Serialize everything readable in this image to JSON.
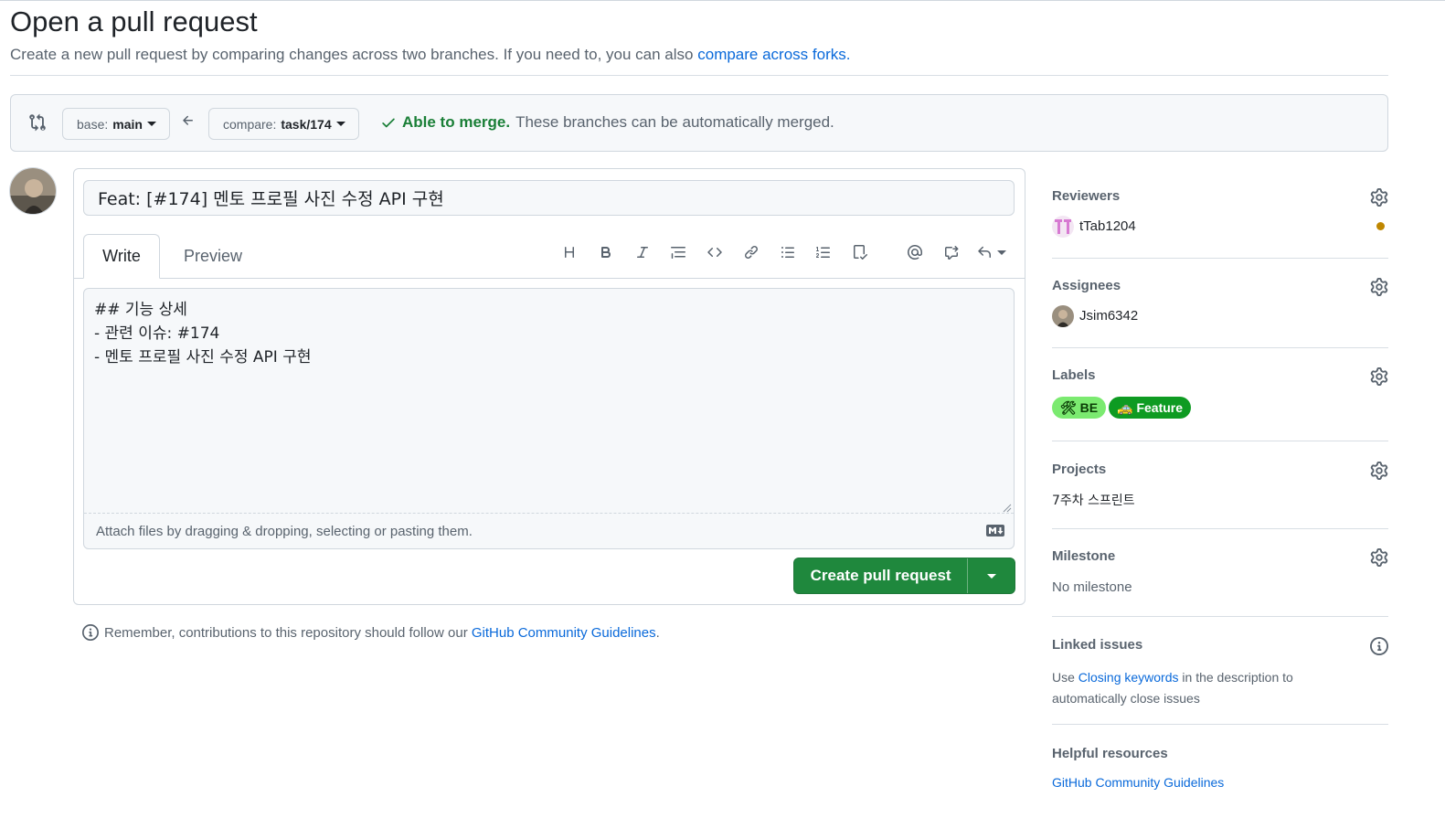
{
  "page": {
    "title": "Open a pull request",
    "subtitle": "Create a new pull request by comparing changes across two branches. If you need to, you can also",
    "subtitle_link": "compare across forks."
  },
  "range": {
    "base_key": "base:",
    "base_value": "main",
    "compare_key": "compare:",
    "compare_value": "task/174",
    "merge_ok": "Able to merge.",
    "merge_text": "These branches can be automatically merged."
  },
  "form": {
    "title_value": "Feat: [#174] 멘토 프로필 사진 수정 API 구현",
    "tabs": [
      "Write",
      "Preview"
    ],
    "body": "## 기능 상세\n- 관련 이슈: #174\n- 멘토 프로필 사진 수정 API 구현",
    "attach_hint": "Attach files by dragging & dropping, selecting or pasting them.",
    "submit_label": "Create pull request"
  },
  "note": {
    "text": "Remember, contributions to this repository should follow our",
    "link": "GitHub Community Guidelines",
    "end": "."
  },
  "sidebar": {
    "reviewers": {
      "title": "Reviewers",
      "user": "tTab1204"
    },
    "assignees": {
      "title": "Assignees",
      "user": "Jsim6342"
    },
    "labels": {
      "title": "Labels",
      "items": [
        {
          "name": "BE",
          "emoji": "🛠",
          "bg": "#7bea70",
          "fg": "#0b3d06"
        },
        {
          "name": "Feature",
          "emoji": "🚕",
          "bg": "#0e9b22",
          "fg": "#ffffff"
        }
      ]
    },
    "projects": {
      "title": "Projects",
      "value": "7주차 스프린트"
    },
    "milestone": {
      "title": "Milestone",
      "value": "No milestone"
    },
    "linked": {
      "title": "Linked issues",
      "pre": "Use",
      "link": "Closing keywords",
      "post": "in the description to",
      "line2": "automatically close issues"
    },
    "helpful": {
      "title": "Helpful resources",
      "link": "GitHub Community Guidelines"
    }
  },
  "colors": {
    "accent": "#0969da",
    "success": "#1a7f37",
    "button": "#1f883d",
    "pending": "#bf8700"
  }
}
